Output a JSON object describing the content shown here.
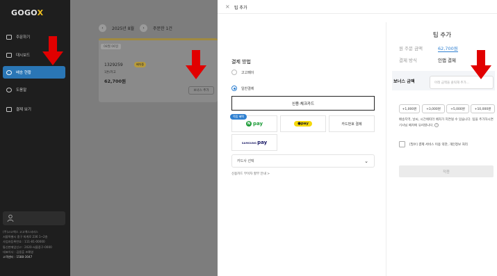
{
  "sidebar": {
    "logo_text": "GOGO",
    "logo_accent": "X",
    "nav": [
      {
        "label": "주문하기",
        "icon": "phone-icon"
      },
      {
        "label": "대시보드",
        "icon": "dashboard-icon"
      },
      {
        "label": "배송 현황",
        "icon": "location-icon"
      },
      {
        "label": "도움말",
        "icon": "help-icon"
      },
      {
        "label": "결제 보기",
        "icon": "card-icon"
      }
    ],
    "company_lines": [
      "(주)고고엑스 고고엑스서비스",
      "서울특별시 중구 퇴계로 236 1~2층",
      "사업자등록번호 : 111-81-00000",
      "통신판매업신고 : 2020-서울중구-0000",
      "대표이사 : 김용훈 조예영",
      "고객센터 : 1588-3047"
    ],
    "company_head": "(주)고고엑스",
    "colors": {
      "active": "#2a76b5",
      "bg": "#1e1e1e"
    }
  },
  "background": {
    "date_label": "2025년 8월",
    "prev": "‹",
    "next": "›",
    "order_count_label": "주문한 1건",
    "order_tag": "08월 06일",
    "order_no": "1329259",
    "order_badge": "배차중",
    "order_sub": "1톤/카고",
    "order_amount": "62,700원",
    "bonus_button": "보너스 추가"
  },
  "modal": {
    "close": "×",
    "title": "팁 추가",
    "payment": {
      "title": "결제 방법",
      "options": [
        "고고페이",
        "일반결제"
      ],
      "card_button": "신용·체크카드",
      "badge": "적립 혜택",
      "npay": "pay",
      "npay_n": "N",
      "kpay": "●pay",
      "phone_pay": "카드번호 결제",
      "spay_small": "SAMSUNG",
      "spay_big": "pay",
      "card_select": "카드사 선택",
      "benefit_link": "신용카드 무이자 할부 안내 >"
    },
    "tip": {
      "title": "팁 추가",
      "original_label": "원 주문 금액",
      "original_value": "62,700원",
      "method_label": "결제 방식",
      "method_value": "인앱 결제",
      "bonus_label": "보너스 금액",
      "bonus_placeholder": "아래 금액을 클릭해 추가...",
      "amounts": [
        "+1,000원",
        "+3,000원",
        "+5,000원",
        "+10,000원"
      ],
      "notice": "배송지역, 날씨, 시간에따라 배차가 지연될 수 있습니다. 팁을 추가하시면 기사님 배차에 유리합니다.",
      "info": "?",
      "agree": "[필수] 결제 서비스 이용 약관, 개인정보 처리",
      "apply": "적용"
    },
    "colors": {
      "link": "#2f80d1",
      "arrow": "#e10000"
    }
  }
}
